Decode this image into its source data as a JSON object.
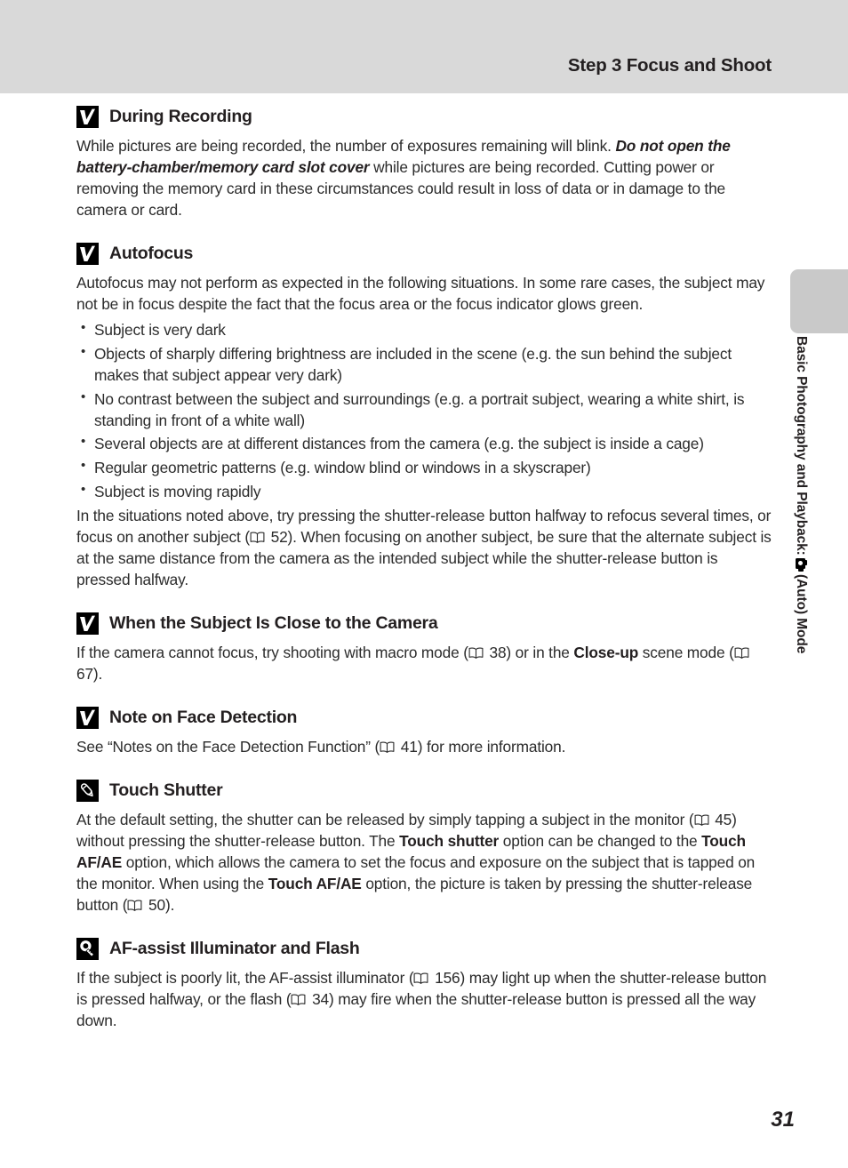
{
  "header": {
    "title": "Step 3 Focus and Shoot"
  },
  "sidebar": {
    "label_before": "Basic Photography and Playback: ",
    "icon": "camera-auto-icon",
    "label_after": "(Auto) Mode"
  },
  "page_number": "31",
  "sections": [
    {
      "id": "during-recording",
      "icon": "note-check-icon",
      "title": "During Recording",
      "paragraphs": [
        [
          {
            "t": "text",
            "v": "While pictures are being recorded, the number of exposures remaining will blink. "
          },
          {
            "t": "bolditalic",
            "v": "Do not open the battery-chamber/memory card slot cover"
          },
          {
            "t": "text",
            "v": " while pictures are being recorded. Cutting power or removing the memory card in these circumstances could result in loss of data or in damage to the camera or card."
          }
        ]
      ]
    },
    {
      "id": "autofocus",
      "icon": "note-check-icon",
      "title": "Autofocus",
      "paragraphs": [
        [
          {
            "t": "text",
            "v": "Autofocus may not perform as expected in the following situations. In some rare cases, the subject may not be in focus despite the fact that the focus area or the focus indicator glows green."
          }
        ]
      ],
      "bullets": [
        "Subject is very dark",
        "Objects of sharply differing brightness are included in the scene (e.g. the sun behind the subject makes that subject appear very dark)",
        "No contrast between the subject and surroundings (e.g. a portrait subject, wearing a white shirt, is standing in front of a white wall)",
        "Several objects are at different distances from the camera (e.g. the subject is inside a cage)",
        "Regular geometric patterns (e.g. window blind or windows in a skyscraper)",
        "Subject is moving rapidly"
      ],
      "paragraphs_after": [
        [
          {
            "t": "text",
            "v": "In the situations noted above, try pressing the shutter-release button halfway to refocus several times, or focus on another subject ("
          },
          {
            "t": "book",
            "v": "book-icon"
          },
          {
            "t": "text",
            "v": " 52). When focusing on another subject, be sure that the alternate subject is at the same distance from the camera as the intended subject while the shutter-release button is pressed halfway."
          }
        ]
      ]
    },
    {
      "id": "subject-close-to-camera",
      "icon": "note-check-icon",
      "title": "When the Subject Is Close to the Camera",
      "paragraphs": [
        [
          {
            "t": "text",
            "v": "If the camera cannot focus, try shooting with macro mode ("
          },
          {
            "t": "book",
            "v": "book-icon"
          },
          {
            "t": "text",
            "v": " 38) or in the "
          },
          {
            "t": "bold",
            "v": "Close-up"
          },
          {
            "t": "text",
            "v": " scene mode ("
          },
          {
            "t": "book",
            "v": "book-icon"
          },
          {
            "t": "text",
            "v": " 67)."
          }
        ]
      ]
    },
    {
      "id": "note-face-detection",
      "icon": "note-check-icon",
      "title": "Note on Face Detection",
      "paragraphs": [
        [
          {
            "t": "text",
            "v": "See “Notes on the Face Detection Function” ("
          },
          {
            "t": "book",
            "v": "book-icon"
          },
          {
            "t": "text",
            "v": " 41) for more information."
          }
        ]
      ]
    },
    {
      "id": "touch-shutter",
      "icon": "pencil-icon",
      "title": "Touch Shutter",
      "paragraphs": [
        [
          {
            "t": "text",
            "v": "At the default setting, the shutter can be released by simply tapping a subject in the monitor ("
          },
          {
            "t": "book",
            "v": "book-icon"
          },
          {
            "t": "text",
            "v": " 45) without pressing the shutter-release button. The "
          },
          {
            "t": "bold",
            "v": "Touch shutter"
          },
          {
            "t": "text",
            "v": " option can be changed to the "
          },
          {
            "t": "bold",
            "v": "Touch AF/AE"
          },
          {
            "t": "text",
            "v": " option, which allows the camera to set the focus and exposure on the subject that is tapped on the monitor. When using the "
          },
          {
            "t": "bold",
            "v": "Touch AF/AE"
          },
          {
            "t": "text",
            "v": " option, the picture is taken by pressing the shutter-release button ("
          },
          {
            "t": "book",
            "v": "book-icon"
          },
          {
            "t": "text",
            "v": " 50)."
          }
        ]
      ]
    },
    {
      "id": "af-assist-illuminator-and-flash",
      "icon": "lightbulb-icon",
      "title": "AF-assist Illuminator and Flash",
      "paragraphs": [
        [
          {
            "t": "text",
            "v": "If the subject is poorly lit, the AF-assist illuminator ("
          },
          {
            "t": "book",
            "v": "book-icon"
          },
          {
            "t": "text",
            "v": " 156) may light up when the shutter-release button is pressed halfway, or the flash ("
          },
          {
            "t": "book",
            "v": "book-icon"
          },
          {
            "t": "text",
            "v": " 34) may fire when the shutter-release button is pressed all the way down."
          }
        ]
      ]
    }
  ]
}
